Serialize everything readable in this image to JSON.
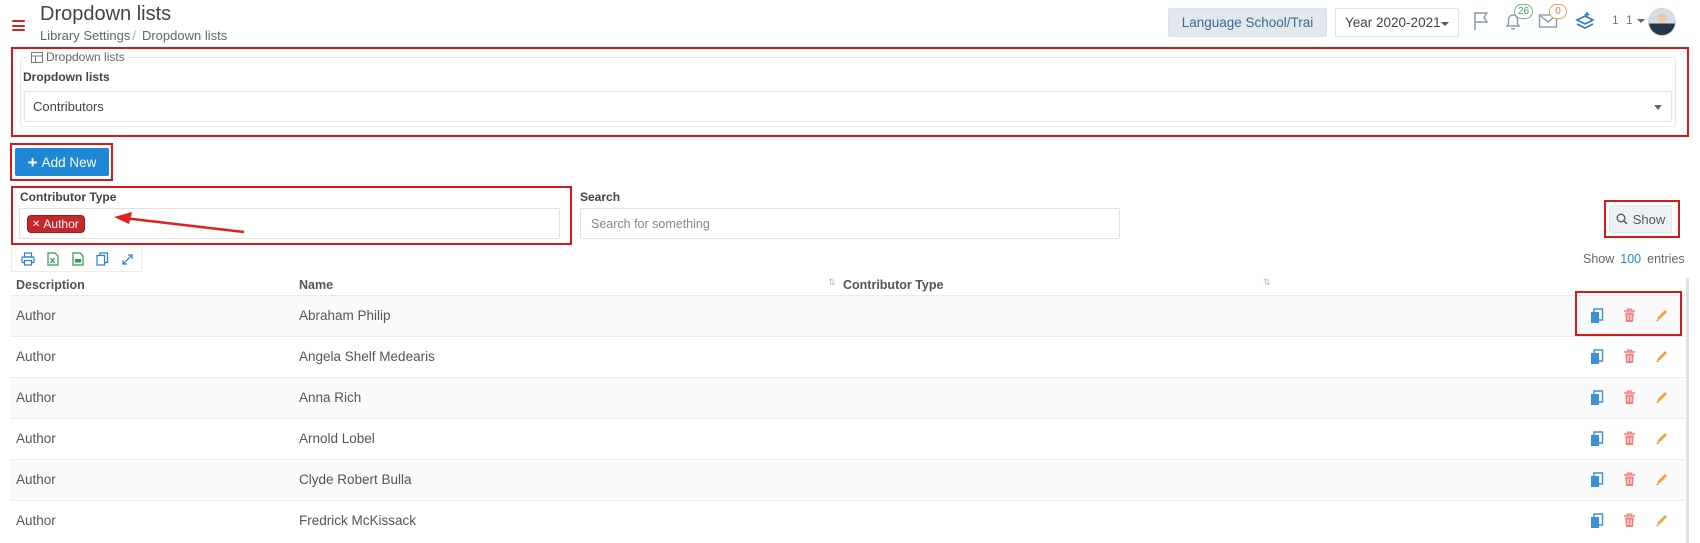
{
  "header": {
    "title": "Dropdown lists",
    "breadcrumb": [
      "Library Settings",
      "Dropdown lists"
    ],
    "school": "Language School/Trai",
    "year": "Year 2020-2021",
    "notifications_count": "26",
    "messages_count": "0",
    "user_label": "1 1"
  },
  "panel": {
    "legend": "Dropdown lists",
    "label": "Dropdown lists",
    "selected": "Contributors"
  },
  "actions": {
    "add_new": "Add New",
    "show": "Show"
  },
  "filters": {
    "contributor_type_label": "Contributor Type",
    "contributor_type_tag": "Author",
    "search_label": "Search",
    "search_placeholder": "Search for something"
  },
  "toolbar": {
    "icons": [
      "print-icon",
      "excel-icon",
      "csv-icon",
      "copy-icon",
      "expand-icon"
    ],
    "show_prefix": "Show",
    "page_size": "100",
    "show_suffix": "entries"
  },
  "table": {
    "columns": [
      "Description",
      "Name",
      "Contributor Type"
    ],
    "rows": [
      {
        "description": "Author",
        "name": "Abraham Philip",
        "type": ""
      },
      {
        "description": "Author",
        "name": "Angela Shelf Medearis",
        "type": ""
      },
      {
        "description": "Author",
        "name": "Anna Rich",
        "type": ""
      },
      {
        "description": "Author",
        "name": "Arnold Lobel",
        "type": ""
      },
      {
        "description": "Author",
        "name": "Clyde Robert Bulla",
        "type": ""
      },
      {
        "description": "Author",
        "name": "Fredrick McKissack",
        "type": ""
      }
    ]
  },
  "colors": {
    "accent": "#1e88d6",
    "highlight": "#d31a1a",
    "tag": "#c7262c",
    "copy_icon": "#3c8fd8",
    "delete_icon": "#f08080",
    "edit_icon": "#f0a040"
  }
}
